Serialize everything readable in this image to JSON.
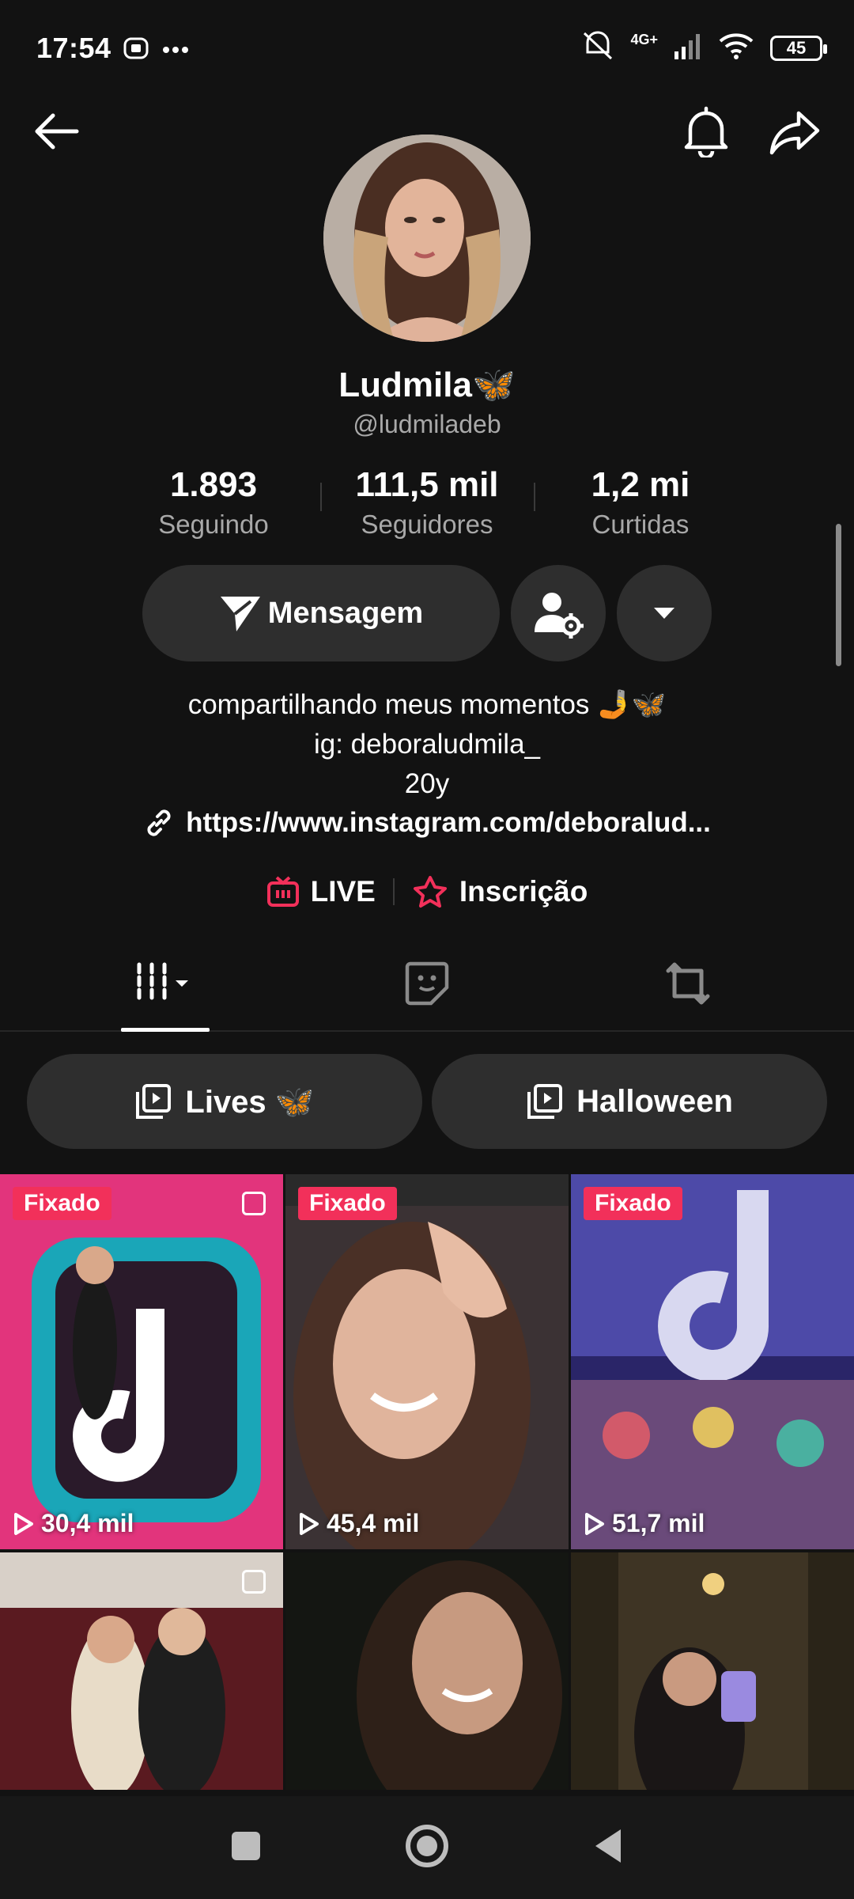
{
  "status_bar": {
    "time": "17:54",
    "network": "4G+",
    "battery": "45"
  },
  "profile": {
    "display_name": "Ludmila🦋",
    "username": "@ludmiladeb",
    "stats": [
      {
        "value": "1.893",
        "label": "Seguindo"
      },
      {
        "value": "111,5 mil",
        "label": "Seguidores"
      },
      {
        "value": "1,2 mi",
        "label": "Curtidas"
      }
    ],
    "message_label": "Mensagem",
    "bio": [
      "compartilhando meus momentos 🤳🦋",
      "ig: deboraludmila_",
      "20y"
    ],
    "link": "https://www.instagram.com/deboralud...",
    "live_label": "LIVE",
    "subscription_label": "Inscrição"
  },
  "playlists": [
    {
      "label": "Lives 🦋"
    },
    {
      "label": "Halloween"
    }
  ],
  "videos": [
    {
      "pinned": "Fixado",
      "views": "30,4 mil",
      "colors": [
        "#e2347c",
        "#8a1b4b"
      ]
    },
    {
      "pinned": "Fixado",
      "views": "45,4 mil",
      "colors": [
        "#6b5a55",
        "#2a2024"
      ]
    },
    {
      "pinned": "Fixado",
      "views": "51,7 mil",
      "colors": [
        "#5a4bb0",
        "#1e1a4a"
      ]
    },
    {
      "pinned": "",
      "views": "",
      "colors": [
        "#7a1c24",
        "#2a0f12"
      ]
    },
    {
      "pinned": "",
      "views": "",
      "colors": [
        "#3b3a30",
        "#121410"
      ]
    },
    {
      "pinned": "",
      "views": "",
      "colors": [
        "#4a3b2a",
        "#1a1510"
      ]
    }
  ],
  "colors": {
    "accent": "#f2305a",
    "surface": "#2e2e2e",
    "background": "#121212"
  }
}
